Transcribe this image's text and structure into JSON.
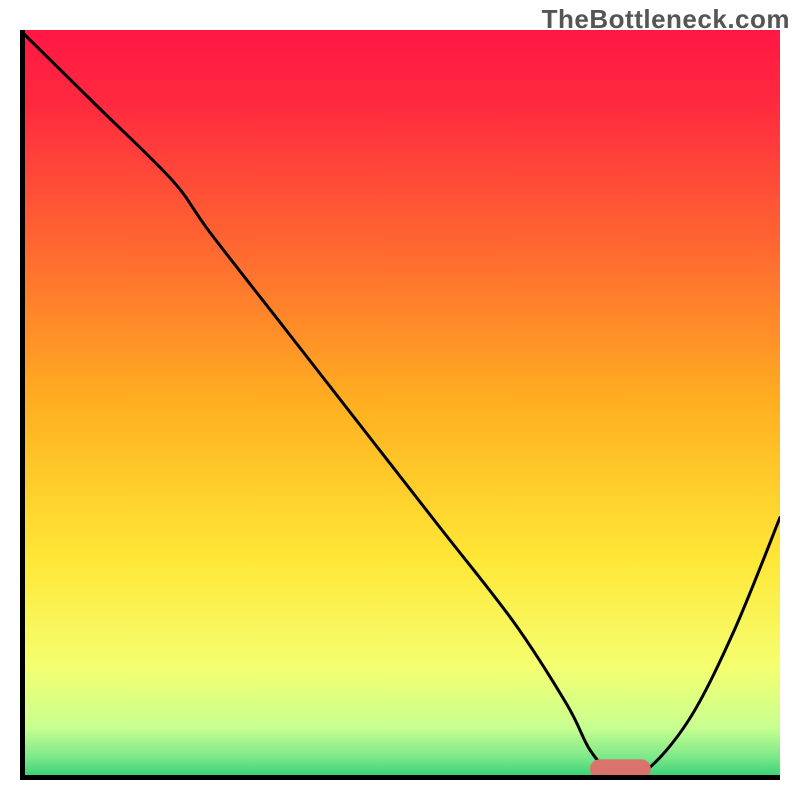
{
  "watermark": "TheBottleneck.com",
  "chart_data": {
    "type": "line",
    "title": "",
    "xlabel": "",
    "ylabel": "",
    "xlim": [
      0,
      100
    ],
    "ylim": [
      0,
      100
    ],
    "grid": false,
    "legend": null,
    "background": {
      "type": "vertical-gradient",
      "stops": [
        {
          "pos": 0.0,
          "color": "#ff1744"
        },
        {
          "pos": 0.1,
          "color": "#ff2a3f"
        },
        {
          "pos": 0.3,
          "color": "#ff6b30"
        },
        {
          "pos": 0.5,
          "color": "#ffb020"
        },
        {
          "pos": 0.7,
          "color": "#ffe635"
        },
        {
          "pos": 0.85,
          "color": "#f4ff70"
        },
        {
          "pos": 0.93,
          "color": "#c8ff90"
        },
        {
          "pos": 0.97,
          "color": "#7be88a"
        },
        {
          "pos": 1.0,
          "color": "#2ecc71"
        }
      ]
    },
    "series": [
      {
        "name": "bottleneck-curve",
        "color": "#000000",
        "width": 3,
        "x": [
          0,
          10,
          20,
          25,
          35,
          45,
          55,
          65,
          72,
          75,
          78,
          82,
          88,
          94,
          100
        ],
        "y": [
          100,
          90,
          80,
          73,
          60,
          47,
          34,
          21,
          10,
          4,
          1,
          1,
          8,
          20,
          35
        ]
      }
    ],
    "marker": {
      "name": "optimal-range",
      "shape": "rounded-bar",
      "x_center": 79,
      "y": 1.5,
      "width": 8,
      "height": 2.5,
      "color": "#d9736b"
    }
  }
}
